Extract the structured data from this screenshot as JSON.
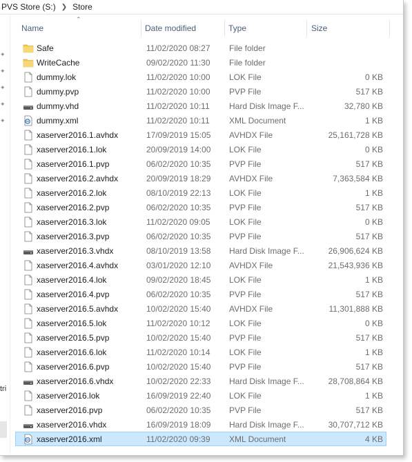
{
  "breadcrumb": [
    "PVS Store (S:)",
    "Store"
  ],
  "columns": {
    "name": "Name",
    "date": "Date modified",
    "type": "Type",
    "size": "Size"
  },
  "nav_fragment": "tri",
  "files": [
    {
      "name": "Safe",
      "date": "11/02/2020 08:27",
      "type": "File folder",
      "size": "",
      "icon": "folder-icon"
    },
    {
      "name": "WriteCache",
      "date": "09/02/2020 11:30",
      "type": "File folder",
      "size": "",
      "icon": "folder-icon"
    },
    {
      "name": "dummy.lok",
      "date": "11/02/2020 10:00",
      "type": "LOK File",
      "size": "0 KB",
      "icon": "file-icon"
    },
    {
      "name": "dummy.pvp",
      "date": "11/02/2020 10:00",
      "type": "PVP File",
      "size": "517 KB",
      "icon": "file-icon"
    },
    {
      "name": "dummy.vhd",
      "date": "11/02/2020 10:11",
      "type": "Hard Disk Image F...",
      "size": "32,780 KB",
      "icon": "disk-icon"
    },
    {
      "name": "dummy.xml",
      "date": "11/02/2020 10:11",
      "type": "XML Document",
      "size": "1 KB",
      "icon": "xml-icon"
    },
    {
      "name": "xaserver2016.1.avhdx",
      "date": "17/09/2019 15:05",
      "type": "AVHDX File",
      "size": "25,161,728 KB",
      "icon": "file-icon"
    },
    {
      "name": "xaserver2016.1.lok",
      "date": "20/09/2019 14:00",
      "type": "LOK File",
      "size": "0 KB",
      "icon": "file-icon"
    },
    {
      "name": "xaserver2016.1.pvp",
      "date": "06/02/2020 10:35",
      "type": "PVP File",
      "size": "517 KB",
      "icon": "file-icon"
    },
    {
      "name": "xaserver2016.2.avhdx",
      "date": "20/09/2019 18:29",
      "type": "AVHDX File",
      "size": "7,363,584 KB",
      "icon": "file-icon"
    },
    {
      "name": "xaserver2016.2.lok",
      "date": "08/10/2019 22:13",
      "type": "LOK File",
      "size": "1 KB",
      "icon": "file-icon"
    },
    {
      "name": "xaserver2016.2.pvp",
      "date": "06/02/2020 10:35",
      "type": "PVP File",
      "size": "517 KB",
      "icon": "file-icon"
    },
    {
      "name": "xaserver2016.3.lok",
      "date": "11/02/2020 09:05",
      "type": "LOK File",
      "size": "0 KB",
      "icon": "file-icon"
    },
    {
      "name": "xaserver2016.3.pvp",
      "date": "06/02/2020 10:35",
      "type": "PVP File",
      "size": "517 KB",
      "icon": "file-icon"
    },
    {
      "name": "xaserver2016.3.vhdx",
      "date": "08/10/2019 13:58",
      "type": "Hard Disk Image F...",
      "size": "26,906,624 KB",
      "icon": "disk-icon"
    },
    {
      "name": "xaserver2016.4.avhdx",
      "date": "03/01/2020 12:10",
      "type": "AVHDX File",
      "size": "21,543,936 KB",
      "icon": "file-icon"
    },
    {
      "name": "xaserver2016.4.lok",
      "date": "09/02/2020 18:45",
      "type": "LOK File",
      "size": "1 KB",
      "icon": "file-icon"
    },
    {
      "name": "xaserver2016.4.pvp",
      "date": "06/02/2020 10:35",
      "type": "PVP File",
      "size": "517 KB",
      "icon": "file-icon"
    },
    {
      "name": "xaserver2016.5.avhdx",
      "date": "10/02/2020 15:40",
      "type": "AVHDX File",
      "size": "11,301,888 KB",
      "icon": "file-icon"
    },
    {
      "name": "xaserver2016.5.lok",
      "date": "11/02/2020 10:12",
      "type": "LOK File",
      "size": "0 KB",
      "icon": "file-icon"
    },
    {
      "name": "xaserver2016.5.pvp",
      "date": "10/02/2020 15:40",
      "type": "PVP File",
      "size": "517 KB",
      "icon": "file-icon"
    },
    {
      "name": "xaserver2016.6.lok",
      "date": "11/02/2020 10:14",
      "type": "LOK File",
      "size": "1 KB",
      "icon": "file-icon"
    },
    {
      "name": "xaserver2016.6.pvp",
      "date": "10/02/2020 15:40",
      "type": "PVP File",
      "size": "517 KB",
      "icon": "file-icon"
    },
    {
      "name": "xaserver2016.6.vhdx",
      "date": "10/02/2020 22:33",
      "type": "Hard Disk Image F...",
      "size": "28,708,864 KB",
      "icon": "disk-icon"
    },
    {
      "name": "xaserver2016.lok",
      "date": "16/09/2019 22:40",
      "type": "LOK File",
      "size": "1 KB",
      "icon": "file-icon"
    },
    {
      "name": "xaserver2016.pvp",
      "date": "06/02/2020 10:35",
      "type": "PVP File",
      "size": "517 KB",
      "icon": "file-icon"
    },
    {
      "name": "xaserver2016.vhdx",
      "date": "16/09/2019 18:09",
      "type": "Hard Disk Image F...",
      "size": "30,707,712 KB",
      "icon": "disk-icon"
    },
    {
      "name": "xaserver2016.xml",
      "date": "11/02/2020 09:39",
      "type": "XML Document",
      "size": "4 KB",
      "icon": "xml-icon",
      "selected": true
    }
  ],
  "colors": {
    "selection_bg": "#cce8ff",
    "selection_border": "#99d1ff",
    "folder": "#f3c64b",
    "header_text": "#4c607a",
    "secondary_text": "#6d6d6d"
  }
}
